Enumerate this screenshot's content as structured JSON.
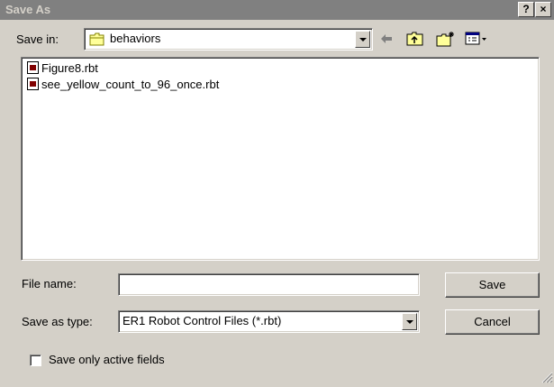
{
  "dialog": {
    "title": "Save As",
    "help_label": "?",
    "close_label": "×"
  },
  "toolbar": {
    "save_in_label": "Save in:",
    "save_in_value": "behaviors",
    "icons": [
      "back-arrow-icon",
      "up-folder-icon",
      "new-folder-icon",
      "view-menu-icon"
    ]
  },
  "file_list": {
    "items": [
      {
        "name": "Figure8.rbt"
      },
      {
        "name": "see_yellow_count_to_96_once.rbt"
      }
    ]
  },
  "form": {
    "file_name_label": "File name:",
    "file_name_value": "",
    "save_as_type_label": "Save as type:",
    "save_as_type_value": "ER1 Robot Control Files (*.rbt)",
    "save_button": "Save",
    "cancel_button": "Cancel",
    "checkbox_label": "Save only active fields",
    "checkbox_checked": false
  },
  "colors": {
    "titlebar": "#808080",
    "title_text": "#d4d0c8",
    "face": "#d4d0c8"
  }
}
